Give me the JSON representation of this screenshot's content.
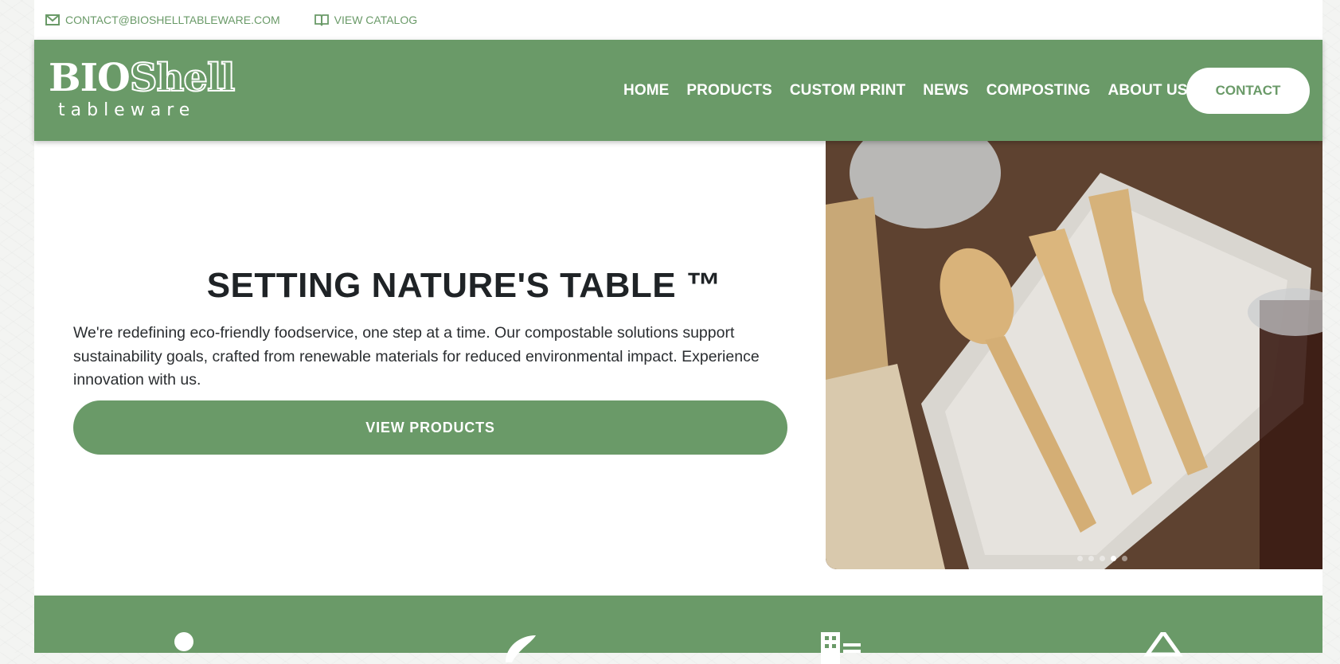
{
  "topbar": {
    "email": "CONTACT@BIOSHELLTABLEWARE.COM",
    "email_icon": "mail-icon",
    "catalog": "VIEW CATALOG",
    "catalog_icon": "book-icon"
  },
  "header": {
    "logo_line1": "BIOShell",
    "logo_line2": "tableware",
    "nav": [
      "HOME",
      "PRODUCTS",
      "CUSTOM PRINT",
      "NEWS",
      "COMPOSTING",
      "ABOUT US"
    ],
    "contact_label": "CONTACT",
    "bg_color": "#6a9a68"
  },
  "hero": {
    "title": "SETTING NATURE'S TABLE ™",
    "text": "We're redefining eco-friendly foodservice, one step at a time. Our compostable solutions support sustainability goals, crafted from renewable materials for reduced environmental impact. Experience innovation with us.",
    "cta_label": "VIEW PRODUCTS",
    "image": "bamboo-cutlery-photo",
    "slides": 5,
    "active_slide": 4
  },
  "features": {
    "icons": [
      "person-icon",
      "leaf-icon",
      "building-icon",
      "recycle-icon"
    ]
  },
  "colors": {
    "accent": "#6a9a68",
    "heading": "#1f2326",
    "body": "#2a2d30"
  }
}
